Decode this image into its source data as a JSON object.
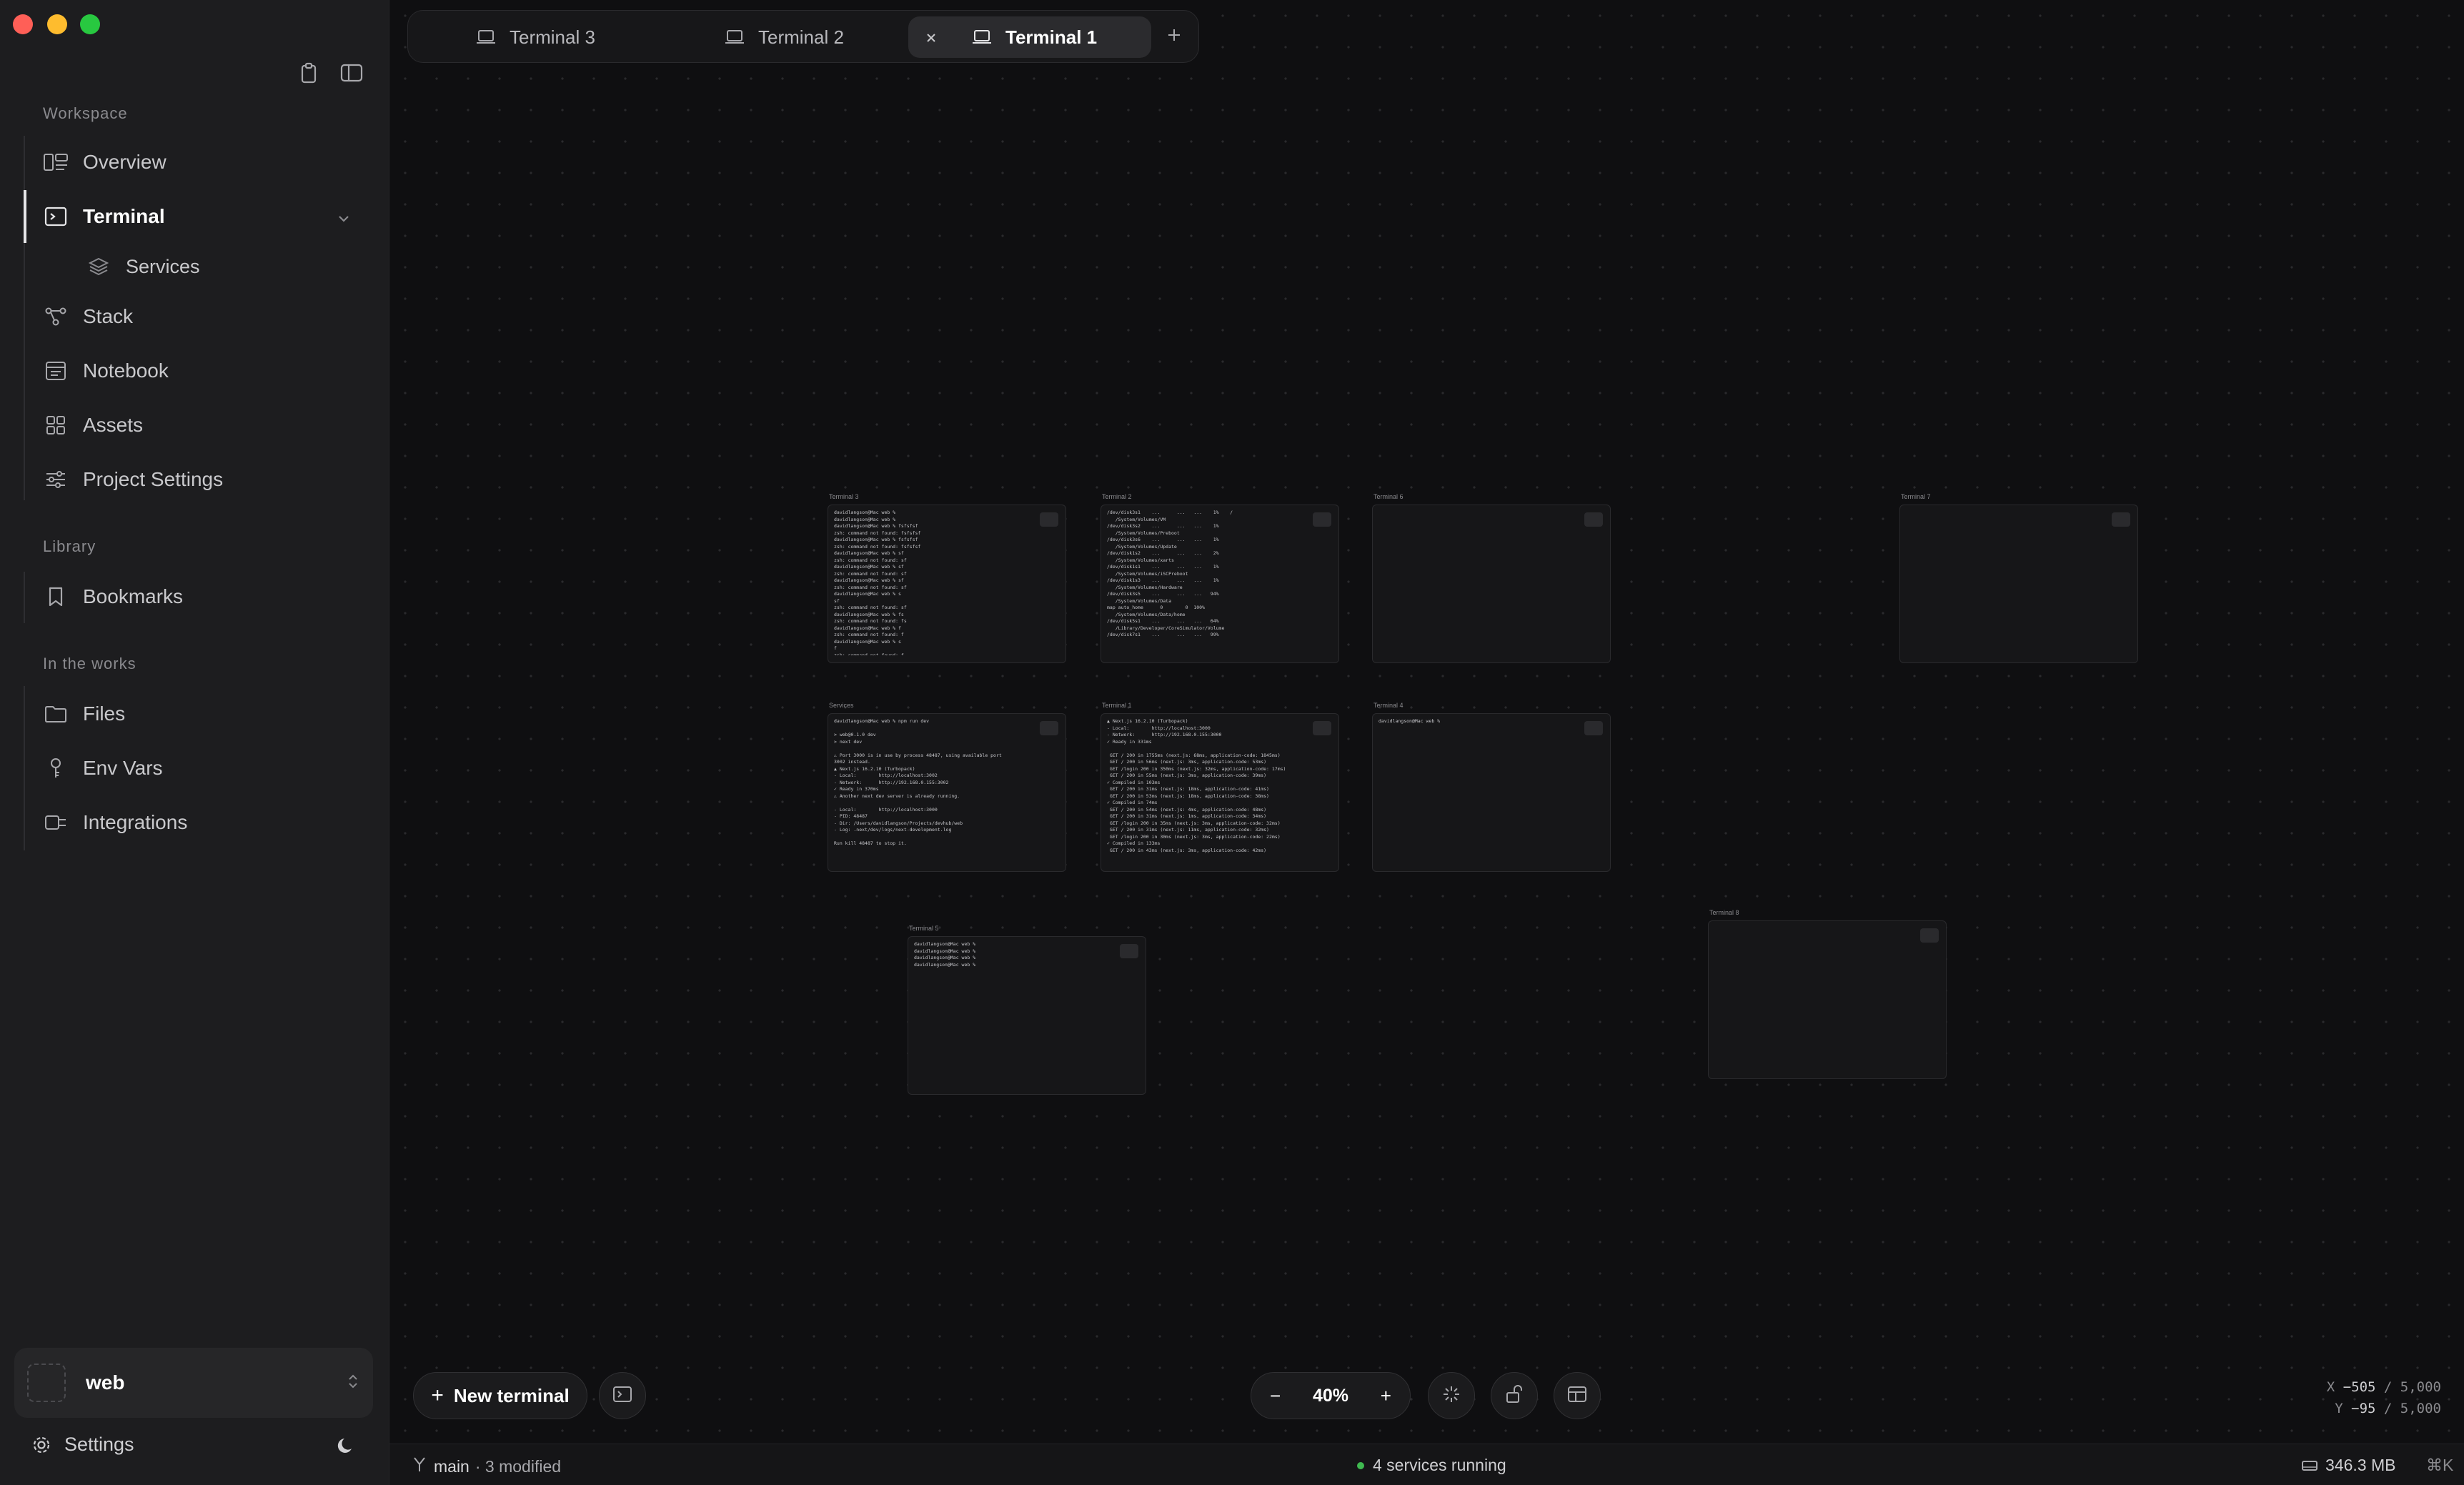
{
  "sidebar": {
    "sections": {
      "workspace": "Workspace",
      "library": "Library",
      "works": "In the works"
    },
    "items": {
      "overview": "Overview",
      "terminal": "Terminal",
      "services": "Services",
      "stack": "Stack",
      "notebook": "Notebook",
      "assets": "Assets",
      "project_settings": "Project Settings",
      "bookmarks": "Bookmarks",
      "files": "Files",
      "env_vars": "Env Vars",
      "integrations": "Integrations"
    },
    "workspace_name": "web",
    "settings_label": "Settings"
  },
  "tabs": [
    "Terminal 3",
    "Terminal 2",
    "Terminal 1"
  ],
  "active_tab": "Terminal 1",
  "cards": [
    {
      "label": "Terminal 3",
      "lines": "davidlangson@Mac web %\ndavidlangson@Mac web %\ndavidlangson@Mac web % fsfsfsf\nzsh: command not found: fsfsfsf\ndavidlangson@Mac web % fsfsfsf\nzsh: command not found: fsfsfsf\ndavidlangson@Mac web % sf\nzsh: command not found: sf\ndavidlangson@Mac web % sf\nzsh: command not found: sf\ndavidlangson@Mac web % sf\nzsh: command not found: sf\ndavidlangson@Mac web % s\nsf\nzsh: command not found: sf\ndavidlangson@Mac web % fs\nzsh: command not found: fs\ndavidlangson@Mac web % f\nzsh: command not found: f\ndavidlangson@Mac web % s\nf\nzsh: command not found: f\ndavidlangson@Mac web % fs\nzsh: command not found: fs"
    },
    {
      "label": "Terminal 2",
      "lines": "/dev/disk3s1    ...      ...   ...    1%    /\n   /System/Volumes/VM\n/dev/disk3s2    ...      ...   ...    1%\n   /System/Volumes/Preboot\n/dev/disk3s6    ...      ...   ...    1%\n   /System/Volumes/Update\n/dev/disk1s2    ...      ...   ...    2%\n   /System/Volumes/xarts\n/dev/disk1s1    ...      ...   ...    1%\n   /System/Volumes/iSCPreboot\n/dev/disk1s3    ...      ...   ...    1%\n   /System/Volumes/Hardware\n/dev/disk3s5    ...      ...   ...   94%\n   /System/Volumes/Data\nmap auto_home      0        0  100%\n   /System/Volumes/Data/home\n/dev/disk5s1    ...      ...   ...   64%\n   /Library/Developer/CoreSimulator/Volume\n/dev/disk7s1    ...      ...   ...   99%"
    },
    {
      "label": "Terminal 6",
      "lines": ""
    },
    {
      "label": "Terminal 7",
      "lines": ""
    },
    {
      "label": "Services",
      "lines": "davidlangson@Mac web % npm run dev\n\n> web@0.1.0 dev\n> next dev\n\n⚠ Port 3000 is in use by process 48487, using available port\n3002 instead.\n▲ Next.js 16.2.10 (Turbopack)\n- Local:        http://localhost:3002\n- Network:      http://192.168.0.155:3002\n✓ Ready in 370ms\n⚠ Another next dev server is already running.\n\n- Local:        http://localhost:3000\n- PID: 48487\n- Dir: /Users/davidlangson/Projects/devhub/web\n- Log: .next/dev/logs/next-development.log\n\nRun kill 48487 to stop it."
    },
    {
      "label": "Terminal 1",
      "lines": "▲ Next.js 16.2.10 (Turbopack)\n- Local:        http://localhost:3000\n- Network:      http://192.168.0.155:3000\n✓ Ready in 331ms\n\n GET / 200 in 1755ms (next.js: 68ms, application-code: 1845ms)\n GET / 200 in 56ms (next.js: 3ms, application-code: 53ms)\n GET /login 200 in 350ms (next.js: 32ms, application-code: 17ms)\n GET / 200 in 55ms (next.js: 3ms, application-code: 39ms)\n✓ Compiled in 103ms\n GET / 200 in 31ms (next.js: 18ms, application-code: 41ms)\n GET / 200 in 53ms (next.js: 18ms, application-code: 38ms)\n✓ Compiled in 74ms\n GET / 200 in 54ms (next.js: 4ms, application-code: 48ms)\n GET / 200 in 31ms (next.js: 1ms, application-code: 34ms)\n GET /login 200 in 35ms (next.js: 3ms, application-code: 32ms)\n GET / 200 in 31ms (next.js: 11ms, application-code: 32ms)\n GET /login 200 in 30ms (next.js: 3ms, application-code: 22ms)\n✓ Compiled in 133ms\n GET / 200 in 43ms (next.js: 3ms, application-code: 42ms)"
    },
    {
      "label": "Terminal 4",
      "lines": "davidlangson@Mac web %"
    },
    {
      "label": "Terminal 5",
      "lines": "davidlangson@Mac web %\ndavidlangson@Mac web %\ndavidlangson@Mac web %\ndavidlangson@Mac web %"
    },
    {
      "label": "Terminal 8",
      "lines": ""
    }
  ],
  "toolbar": {
    "new_terminal": "New terminal",
    "zoom_minus": "−",
    "zoom": "40%",
    "zoom_plus": "+"
  },
  "coords": {
    "x_label": "X",
    "x": "−505",
    "x_max": "/ 5,000",
    "y_label": "Y",
    "y": "−95",
    "y_max": "/ 5,000"
  },
  "statusbar": {
    "branch": "main",
    "modified": "· 3 modified",
    "services": "4 services running",
    "memory": "346.3 MB",
    "shortcut": "⌘K"
  },
  "colors": {
    "accent_running": "#3fb950",
    "canvas_bg": "#0f0f11",
    "sidebar_bg": "#1d1d1f"
  }
}
